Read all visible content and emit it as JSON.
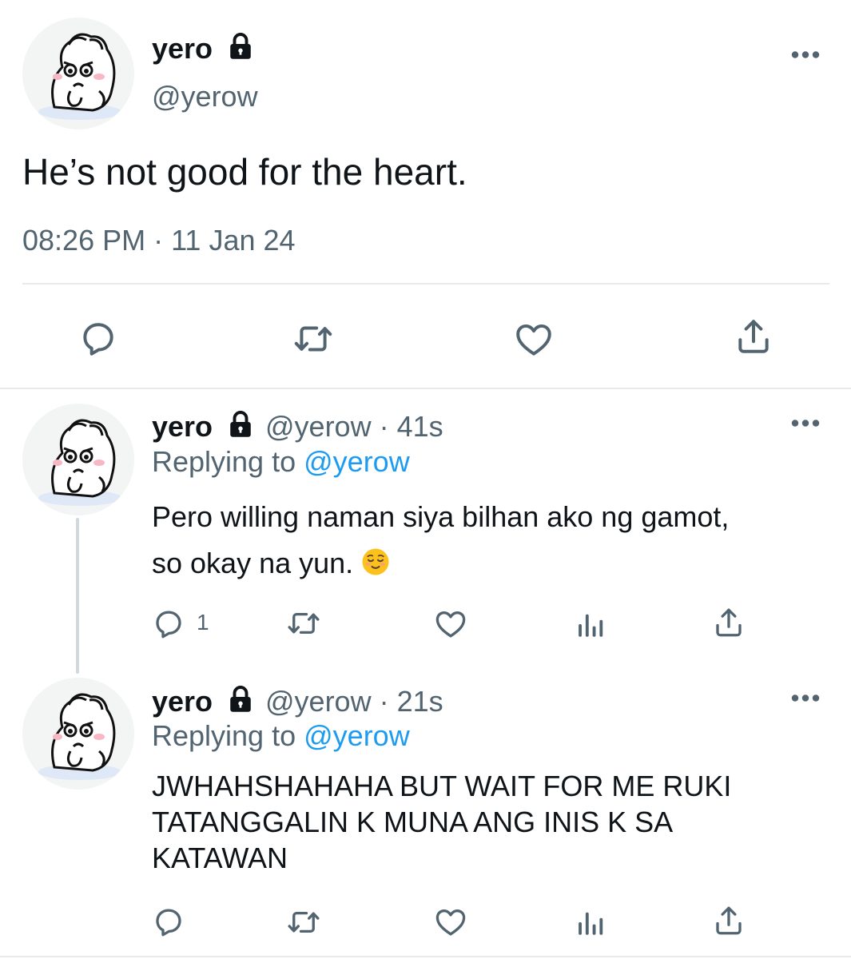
{
  "main_tweet": {
    "display_name": "yero",
    "handle": "@yerow",
    "text": "He’s not good for the heart.",
    "timestamp": "08:26 PM · 11 Jan 24",
    "actions": [
      "reply-icon",
      "retweet-icon",
      "like-icon",
      "share-icon"
    ]
  },
  "replies": [
    {
      "display_name": "yero",
      "meta": "@yerow · 41s",
      "replying_prefix": "Replying to",
      "replying_handle": "@yerow",
      "text_line1": "Pero willing naman siya bilhan ako ng gamot,",
      "text_line2": "so okay na yun.",
      "emoji": "relieved-face",
      "reply_count": "1"
    },
    {
      "display_name": "yero",
      "meta": "@yerow · 21s",
      "replying_prefix": "Replying to",
      "replying_handle": "@yerow",
      "text_line1": "JWHAHSHAHAHA BUT WAIT FOR ME RUKI",
      "text_line2": "TATANGGALIN K MUNA ANG INIS K SA",
      "text_line3": "KATAWAN",
      "reply_count": ""
    }
  ],
  "colors": {
    "text": "#0f1419",
    "secondary": "#536471",
    "link": "#1d9bf0",
    "divider": "#e7ebee"
  }
}
